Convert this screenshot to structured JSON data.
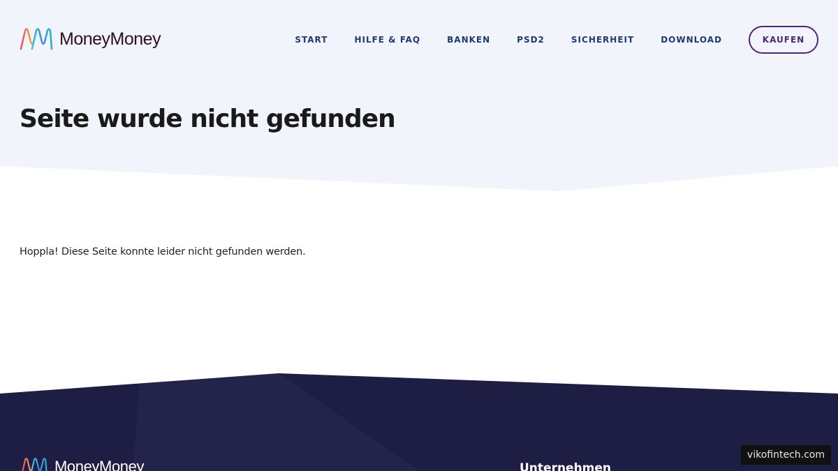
{
  "brand": {
    "name": "MoneyMoney"
  },
  "nav": {
    "items": [
      {
        "label": "START"
      },
      {
        "label": "HILFE & FAQ"
      },
      {
        "label": "BANKEN"
      },
      {
        "label": "PSD2"
      },
      {
        "label": "SICHERHEIT"
      },
      {
        "label": "DOWNLOAD"
      }
    ],
    "buy_label": "KAUFEN"
  },
  "main": {
    "title": "Seite wurde nicht gefunden",
    "message": "Hoppla! Diese Seite konnte leider nicht gefunden werden."
  },
  "footer": {
    "brand_name": "MoneyMoney",
    "column_heading": "Unternehmen"
  },
  "watermark": {
    "text": "vikofintech.com"
  },
  "colors": {
    "hero_background": "#f1f4fa",
    "footer_background": "#1e1e45",
    "nav_text": "#1f3a6e",
    "buy_button": "#4a2a6e",
    "title_text": "#1a1a1a"
  }
}
